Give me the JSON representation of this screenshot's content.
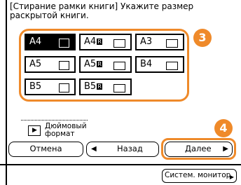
{
  "title": "[Стирание рамки книги] Укажите размер раскрытой книги.",
  "size_buttons": [
    {
      "label": "A4",
      "selected": true
    },
    {
      "label": "A4",
      "mark": "R",
      "selected": false
    },
    {
      "label": "A3",
      "selected": false
    },
    {
      "label": "A5",
      "selected": false
    },
    {
      "label": "A5",
      "mark": "R",
      "selected": false
    },
    {
      "label": "B4",
      "selected": false
    },
    {
      "label": "B5",
      "selected": false
    },
    {
      "label": "B5",
      "mark": "R",
      "selected": false
    }
  ],
  "inch_format": {
    "label": "Дюймовый формат",
    "icon": "triangle-right-icon"
  },
  "buttons": {
    "cancel": "Отмена",
    "back": "Назад",
    "next": "Далее",
    "monitor": "Систем. монитор"
  },
  "callouts": {
    "step3": "3",
    "step4": "4"
  },
  "colors": {
    "accent": "#ef8a2a",
    "selected_bg": "#000000"
  }
}
